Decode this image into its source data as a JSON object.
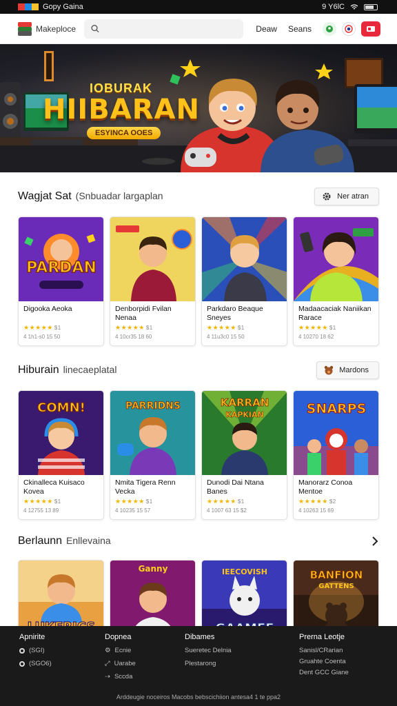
{
  "status_bar": {
    "left": "Gopy Gaina",
    "time": "9 Y6lC"
  },
  "topbar": {
    "brand": "Makeploce",
    "search_placeholder": "",
    "nav": [
      "Deaw",
      "Seans"
    ]
  },
  "hero": {
    "subtitle": "IOBURAK",
    "title": "HIIBARAN",
    "badge": "ESYINCA OOES"
  },
  "sections": [
    {
      "title": "Wagjat Sat",
      "subtitle": "(Snbuadar largaplan",
      "action": "Ner atran",
      "cards": [
        {
          "title": "Digooka Aeoka",
          "stars": "★★★★★",
          "count": "$1",
          "meta": "4 1h1-s0   15 50"
        },
        {
          "title": "Denborpidi Fvilan Nenaa",
          "stars": "★★★★★",
          "count": "$1",
          "meta": "4 10cr35   18 60"
        },
        {
          "title": "Parkdaro Beaque Sneyes",
          "stars": "★★★★★",
          "count": "$1",
          "meta": "4 11u3c0   15 50"
        },
        {
          "title": "Madaacaciak Naniikan Rarace",
          "stars": "★★★★★",
          "count": "$1",
          "meta": "4 10270   18 62"
        }
      ]
    },
    {
      "title": "Hiburain",
      "subtitle": "linecaeplatal",
      "action": "Mardons",
      "cards": [
        {
          "title": "Ckinalleca Kuisaco Kovea",
          "stars": "★★★★★",
          "count": "$1",
          "meta": "4 12755   13 89"
        },
        {
          "title": "Nmita Tigera Renn Vecka",
          "stars": "★★★★★",
          "count": "$1",
          "meta": "4 10235   15 57"
        },
        {
          "title": "Dunodi Dai Ntana Banes",
          "stars": "★★★★★",
          "count": "$1",
          "meta": "4 1007 63   15 $2"
        },
        {
          "title": "Manorarz Conoa Mentoe",
          "stars": "★★★★★",
          "count": "$2",
          "meta": "4 10263   15 69"
        }
      ]
    },
    {
      "title": "Berlaunn",
      "subtitle": "Enllevaina",
      "cards": [
        {
          "label": "LUKERICS"
        },
        {
          "label": "Ganny"
        },
        {
          "label": "GAAMEE"
        },
        {
          "label": "BANFION GATTENS"
        }
      ]
    }
  ],
  "thumb_labels": {
    "s1": [
      "PARDAN",
      "",
      "",
      ""
    ],
    "s2": [
      "COMN!",
      "PARRIDNS",
      "KARRAN KAPKIAN",
      "SNARPS"
    ]
  },
  "footer": {
    "cols": [
      {
        "head": "Apnirite",
        "items": [
          "(SGI)",
          "(SGO6)"
        ]
      },
      {
        "head": "Dopnea",
        "items": [
          "Ecnie",
          "Uarabe",
          "Sccda"
        ]
      },
      {
        "head": "Dibames",
        "items": [
          "Sueretec Delnia",
          "Plestarong"
        ]
      },
      {
        "head": "Prerna Leotje",
        "items": [
          "Sanisl/CRarian",
          "Gruahte Coenta",
          "Dent GCC Giane"
        ]
      }
    ],
    "copyright": "Arddeugie noceiros Macobs bebscichiion antesa4 1 te ppa2"
  },
  "colors": {
    "accent": "#e8283b",
    "star": "#f4b400",
    "hero_title": "#ffc21a",
    "footer_bg": "#1a1a1a"
  }
}
